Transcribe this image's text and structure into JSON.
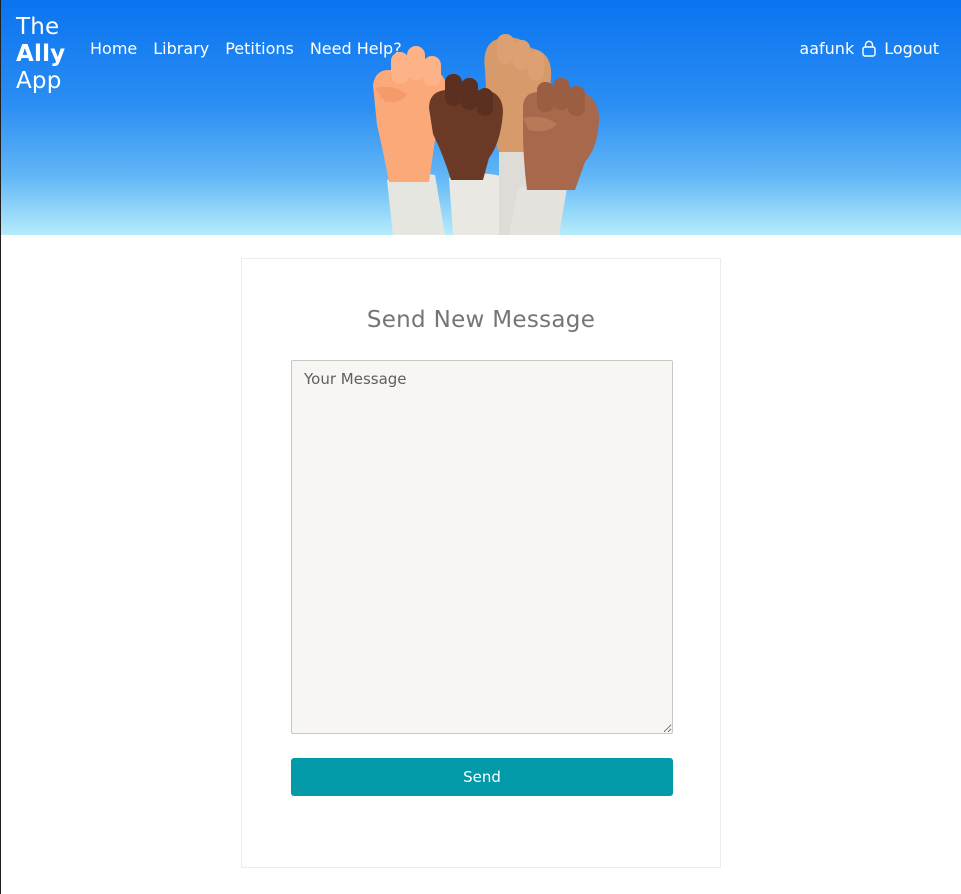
{
  "brand": {
    "line1": "The",
    "line2": "Ally",
    "line3": "App"
  },
  "nav": {
    "home": "Home",
    "library": "Library",
    "petitions": "Petitions",
    "help": "Need Help?"
  },
  "user": {
    "name": "aafunk",
    "icon": "lock-icon",
    "logout": "Logout"
  },
  "hero": {
    "image": "raised-fists-illustration",
    "colors": {
      "sky_top": "#0a74f1",
      "sky_bottom": "#b5ecfb"
    }
  },
  "form": {
    "title": "Send New Message",
    "message_placeholder": "Your Message",
    "message_value": "",
    "send_label": "Send"
  },
  "colors": {
    "accent": "#0299a9",
    "title_text": "#757575"
  }
}
